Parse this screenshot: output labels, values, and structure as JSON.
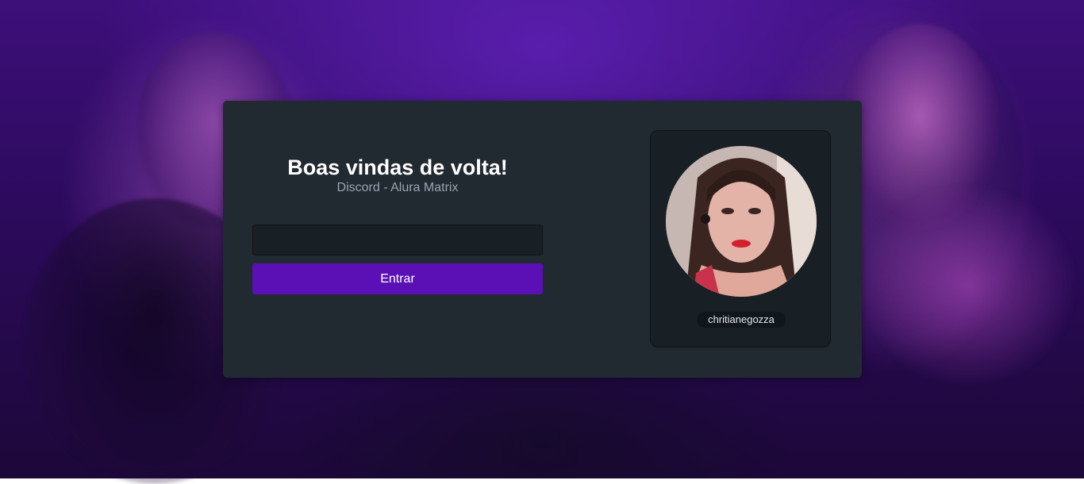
{
  "login": {
    "title": "Boas vindas de volta!",
    "subtitle": "Discord - Alura Matrix",
    "username_value": "",
    "submit_label": "Entrar"
  },
  "profile": {
    "username": "chritianegozza"
  },
  "colors": {
    "background_accent": "#3d0f7a",
    "card": "#212931",
    "input": "#181f25",
    "button": "#5a10b4",
    "text_primary": "#ffffff",
    "text_secondary": "#9aa5b1"
  }
}
